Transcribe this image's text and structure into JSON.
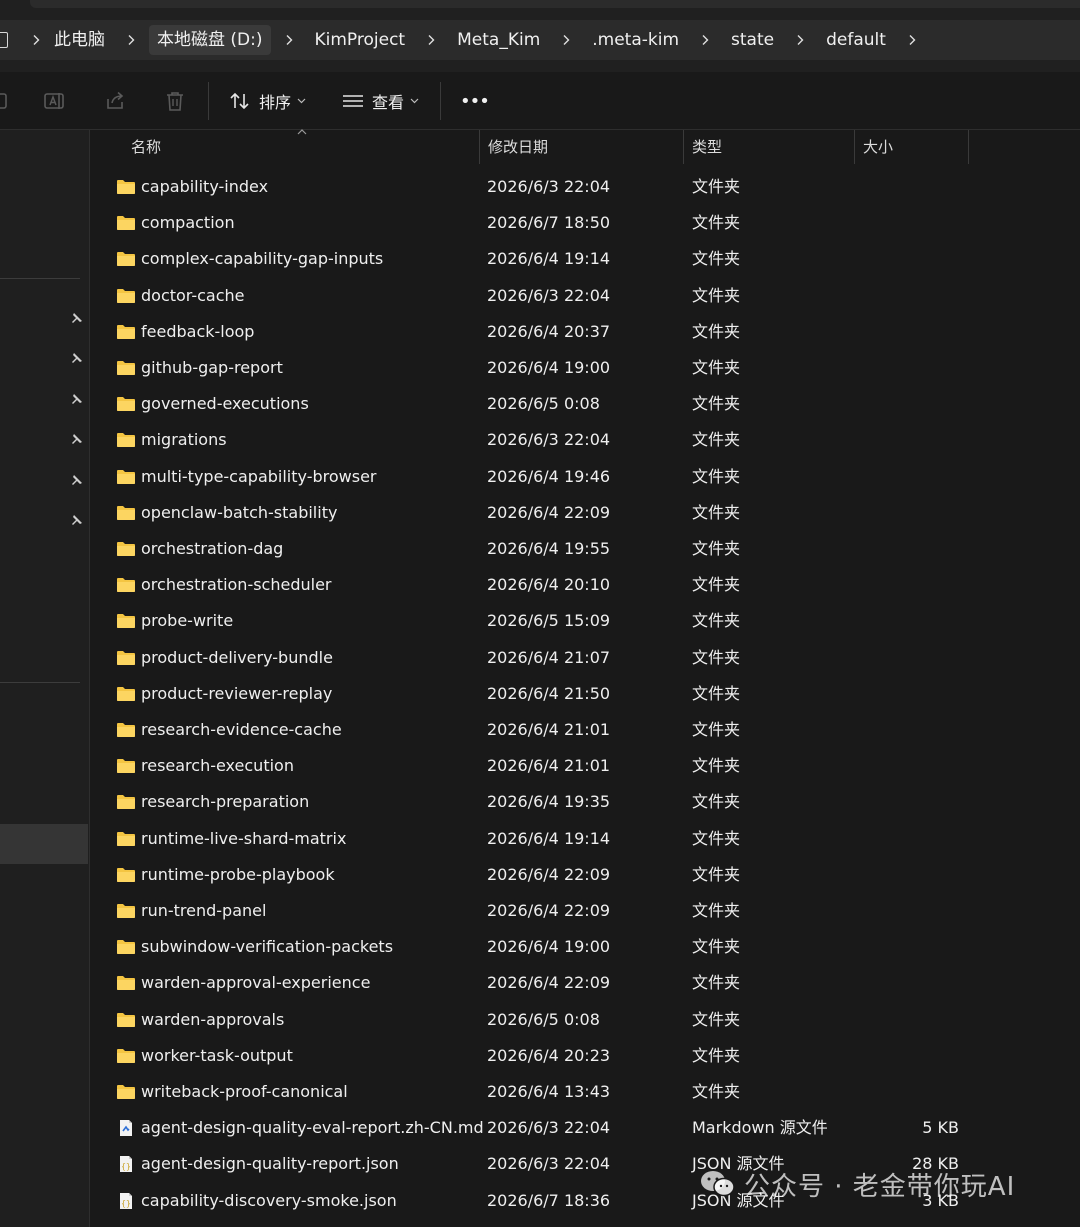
{
  "breadcrumb": {
    "items": [
      "此电脑",
      "本地磁盘 (D:)",
      "KimProject",
      "Meta_Kim",
      ".meta-kim",
      "state",
      "default"
    ],
    "active_index": 1
  },
  "toolbar": {
    "icons": [
      "rename-icon",
      "share-icon",
      "delete-icon"
    ],
    "sort_label": "排序",
    "view_label": "查看",
    "more_label": "•••"
  },
  "columns": {
    "name": "名称",
    "date": "修改日期",
    "type": "类型",
    "size": "大小"
  },
  "files": [
    {
      "name": "capability-index",
      "date": "2026/6/3 22:04",
      "type": "文件夹",
      "size": "",
      "icon": "folder"
    },
    {
      "name": "compaction",
      "date": "2026/6/7 18:50",
      "type": "文件夹",
      "size": "",
      "icon": "folder"
    },
    {
      "name": "complex-capability-gap-inputs",
      "date": "2026/6/4 19:14",
      "type": "文件夹",
      "size": "",
      "icon": "folder"
    },
    {
      "name": "doctor-cache",
      "date": "2026/6/3 22:04",
      "type": "文件夹",
      "size": "",
      "icon": "folder"
    },
    {
      "name": "feedback-loop",
      "date": "2026/6/4 20:37",
      "type": "文件夹",
      "size": "",
      "icon": "folder"
    },
    {
      "name": "github-gap-report",
      "date": "2026/6/4 19:00",
      "type": "文件夹",
      "size": "",
      "icon": "folder"
    },
    {
      "name": "governed-executions",
      "date": "2026/6/5 0:08",
      "type": "文件夹",
      "size": "",
      "icon": "folder"
    },
    {
      "name": "migrations",
      "date": "2026/6/3 22:04",
      "type": "文件夹",
      "size": "",
      "icon": "folder"
    },
    {
      "name": "multi-type-capability-browser",
      "date": "2026/6/4 19:46",
      "type": "文件夹",
      "size": "",
      "icon": "folder"
    },
    {
      "name": "openclaw-batch-stability",
      "date": "2026/6/4 22:09",
      "type": "文件夹",
      "size": "",
      "icon": "folder"
    },
    {
      "name": "orchestration-dag",
      "date": "2026/6/4 19:55",
      "type": "文件夹",
      "size": "",
      "icon": "folder"
    },
    {
      "name": "orchestration-scheduler",
      "date": "2026/6/4 20:10",
      "type": "文件夹",
      "size": "",
      "icon": "folder"
    },
    {
      "name": "probe-write",
      "date": "2026/6/5 15:09",
      "type": "文件夹",
      "size": "",
      "icon": "folder"
    },
    {
      "name": "product-delivery-bundle",
      "date": "2026/6/4 21:07",
      "type": "文件夹",
      "size": "",
      "icon": "folder"
    },
    {
      "name": "product-reviewer-replay",
      "date": "2026/6/4 21:50",
      "type": "文件夹",
      "size": "",
      "icon": "folder"
    },
    {
      "name": "research-evidence-cache",
      "date": "2026/6/4 21:01",
      "type": "文件夹",
      "size": "",
      "icon": "folder"
    },
    {
      "name": "research-execution",
      "date": "2026/6/4 21:01",
      "type": "文件夹",
      "size": "",
      "icon": "folder"
    },
    {
      "name": "research-preparation",
      "date": "2026/6/4 19:35",
      "type": "文件夹",
      "size": "",
      "icon": "folder"
    },
    {
      "name": "runtime-live-shard-matrix",
      "date": "2026/6/4 19:14",
      "type": "文件夹",
      "size": "",
      "icon": "folder"
    },
    {
      "name": "runtime-probe-playbook",
      "date": "2026/6/4 22:09",
      "type": "文件夹",
      "size": "",
      "icon": "folder"
    },
    {
      "name": "run-trend-panel",
      "date": "2026/6/4 22:09",
      "type": "文件夹",
      "size": "",
      "icon": "folder"
    },
    {
      "name": "subwindow-verification-packets",
      "date": "2026/6/4 19:00",
      "type": "文件夹",
      "size": "",
      "icon": "folder"
    },
    {
      "name": "warden-approval-experience",
      "date": "2026/6/4 22:09",
      "type": "文件夹",
      "size": "",
      "icon": "folder"
    },
    {
      "name": "warden-approvals",
      "date": "2026/6/5 0:08",
      "type": "文件夹",
      "size": "",
      "icon": "folder"
    },
    {
      "name": "worker-task-output",
      "date": "2026/6/4 20:23",
      "type": "文件夹",
      "size": "",
      "icon": "folder"
    },
    {
      "name": "writeback-proof-canonical",
      "date": "2026/6/4 13:43",
      "type": "文件夹",
      "size": "",
      "icon": "folder"
    },
    {
      "name": "agent-design-quality-eval-report.zh-CN.md",
      "date": "2026/6/3 22:04",
      "type": "Markdown 源文件",
      "size": "5 KB",
      "icon": "markdown"
    },
    {
      "name": "agent-design-quality-report.json",
      "date": "2026/6/3 22:04",
      "type": "JSON 源文件",
      "size": "28 KB",
      "icon": "json"
    },
    {
      "name": "capability-discovery-smoke.json",
      "date": "2026/6/7 18:36",
      "type": "JSON 源文件",
      "size": "3 KB",
      "icon": "json"
    }
  ],
  "watermark": "公众号 · 老金带你玩AI",
  "colors": {
    "folder": "#f4c542",
    "background": "#191919",
    "text": "#efefef"
  }
}
